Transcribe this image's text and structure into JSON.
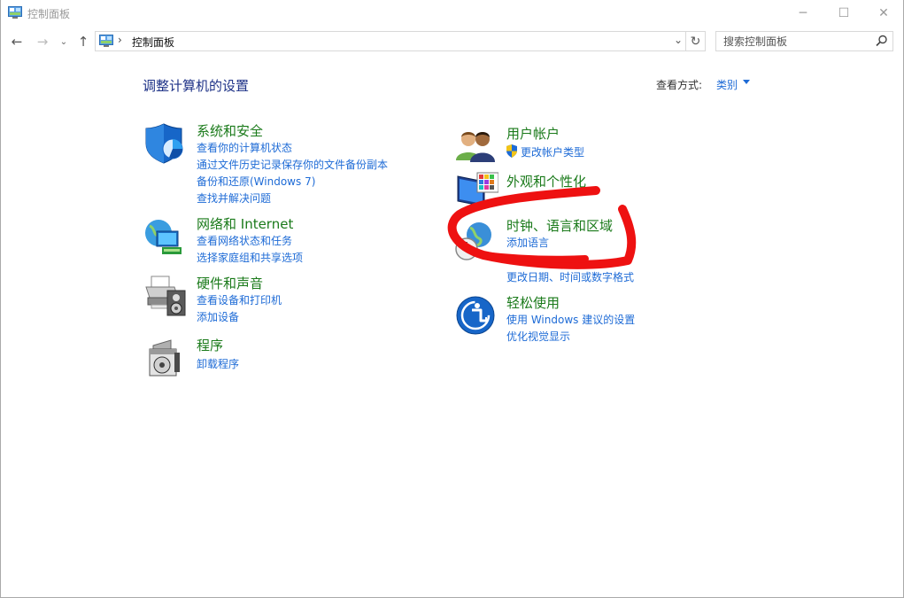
{
  "window": {
    "title": "控制面板",
    "min_glyph": "─",
    "max_glyph": "☐",
    "close_glyph": "✕"
  },
  "nav": {
    "back_glyph": "←",
    "forward_glyph": "→",
    "recent_glyph": "⌄",
    "up_glyph": "↑",
    "address_separator": "›",
    "address_path": "控制面板",
    "address_dropdown_glyph": "⌄",
    "refresh_glyph": "↻",
    "search_placeholder": "搜索控制面板"
  },
  "header": {
    "title": "调整计算机的设置",
    "view_label": "查看方式:",
    "view_value": "类别"
  },
  "categories_left": [
    {
      "title": "系统和安全",
      "links": [
        "查看你的计算机状态",
        "通过文件历史记录保存你的文件备份副本",
        "备份和还原(Windows 7)",
        "查找并解决问题"
      ]
    },
    {
      "title": "网络和 Internet",
      "links": [
        "查看网络状态和任务",
        "选择家庭组和共享选项"
      ]
    },
    {
      "title": "硬件和声音",
      "links": [
        "查看设备和打印机",
        "添加设备"
      ]
    },
    {
      "title": "程序",
      "links": [
        "卸载程序"
      ]
    }
  ],
  "categories_right": [
    {
      "title": "用户帐户",
      "links": [
        "更改帐户类型"
      ]
    },
    {
      "title": "外观和个性化",
      "links": []
    },
    {
      "title": "时钟、语言和区域",
      "links": [
        "添加语言",
        "更改日期、时间或数字格式"
      ]
    },
    {
      "title": "轻松使用",
      "links": [
        "使用 Windows 建议的设置",
        "优化视觉显示"
      ]
    }
  ],
  "colors": {
    "category_title": "#1a7a1a",
    "link": "#1e6bd6",
    "page_title": "#1e3287",
    "annotation_red": "#ee1111"
  }
}
